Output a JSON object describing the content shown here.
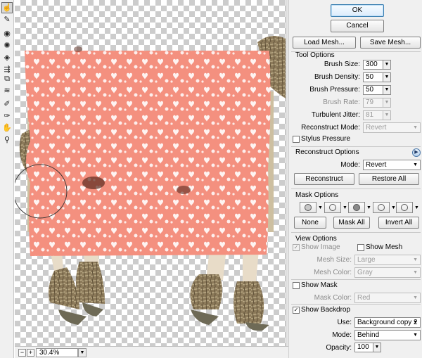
{
  "dialog": {
    "ok_label": "OK",
    "cancel_label": "Cancel",
    "load_mesh_label": "Load Mesh...",
    "save_mesh_label": "Save Mesh..."
  },
  "tool_options": {
    "title": "Tool Options",
    "brush_size_label": "Brush Size:",
    "brush_size": "300",
    "brush_density_label": "Brush Density:",
    "brush_density": "50",
    "brush_pressure_label": "Brush Pressure:",
    "brush_pressure": "50",
    "brush_rate_label": "Brush Rate:",
    "brush_rate": "79",
    "turbulent_jitter_label": "Turbulent Jitter:",
    "turbulent_jitter": "81",
    "reconstruct_mode_label": "Reconstruct Mode:",
    "reconstruct_mode": "Revert",
    "stylus_pressure_label": "Stylus Pressure"
  },
  "reconstruct_options": {
    "title": "Reconstruct Options",
    "mode_label": "Mode:",
    "mode": "Revert",
    "reconstruct_label": "Reconstruct",
    "restore_all_label": "Restore All"
  },
  "mask_options": {
    "title": "Mask Options",
    "none_label": "None",
    "mask_all_label": "Mask All",
    "invert_all_label": "Invert All"
  },
  "view_options": {
    "title": "View Options",
    "show_image_label": "Show Image",
    "show_mesh_label": "Show Mesh",
    "mesh_size_label": "Mesh Size:",
    "mesh_size": "Large",
    "mesh_color_label": "Mesh Color:",
    "mesh_color": "Gray",
    "show_mask_label": "Show Mask",
    "mask_color_label": "Mask Color:",
    "mask_color": "Red",
    "show_backdrop_label": "Show Backdrop",
    "use_label": "Use:",
    "use": "Background copy 2",
    "backdrop_mode_label": "Mode:",
    "backdrop_mode": "Behind",
    "opacity_label": "Opacity:",
    "opacity": "100"
  },
  "status": {
    "zoom": "30.4%"
  },
  "toolbar": {
    "tools": [
      "forward-warp-tool-icon",
      "reconstruct-tool-icon",
      "twirl-clockwise-tool-icon",
      "pucker-tool-icon",
      "bloat-tool-icon",
      "push-left-tool-icon",
      "mirror-tool-icon",
      "turbulence-tool-icon",
      "freeze-mask-tool-icon",
      "thaw-mask-tool-icon",
      "hand-tool-icon",
      "zoom-tool-icon"
    ]
  },
  "colors": {
    "accent": "#3c7fb1",
    "mask_overlay": "#f08a7a",
    "panel_bg": "#f0f0f0",
    "checker": "#cccccc"
  }
}
